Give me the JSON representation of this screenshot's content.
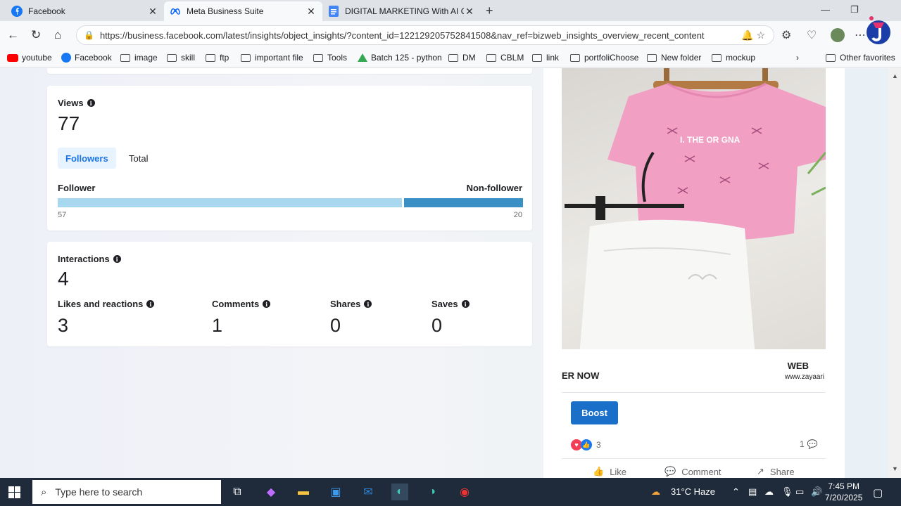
{
  "browser": {
    "tabs": [
      {
        "title": "Facebook",
        "icon": "facebook-icon"
      },
      {
        "title": "Meta Business Suite",
        "icon": "meta-icon"
      },
      {
        "title": "DIGITAL MARKETING With AI Onl",
        "icon": "docs-icon"
      }
    ],
    "url": "https://business.facebook.com/latest/insights/object_insights/?content_id=122129205752841508&nav_ref=bizweb_insights_overview_recent_content",
    "bookmarks": [
      "youtube",
      "Facebook",
      "image",
      "skill",
      "ftp",
      "important file",
      "Tools",
      "Batch 125 - python",
      "DM",
      "CBLM",
      "link",
      "portfoliChoose",
      "New folder",
      "mockup"
    ],
    "other_favorites": "Other favorites"
  },
  "views": {
    "label": "Views",
    "total": "77",
    "tabs": [
      "Followers",
      "Total"
    ],
    "follower_label": "Follower",
    "nonfollower_label": "Non-follower",
    "follower_count": "57",
    "nonfollower_count": "20",
    "follower_share": 0.74
  },
  "interactions": {
    "label": "Interactions",
    "total": "4",
    "metrics": [
      {
        "label": "Likes and reactions",
        "value": "3"
      },
      {
        "label": "Comments",
        "value": "1"
      },
      {
        "label": "Shares",
        "value": "0"
      },
      {
        "label": "Saves",
        "value": "0"
      }
    ]
  },
  "post": {
    "shirt_text": "I. THE OR GNA",
    "order_text": "ER NOW",
    "web_label": "WEB",
    "web_url": "www.zayaari",
    "boost_label": "Boost",
    "reaction_count": "3",
    "comment_count": "1",
    "actions": [
      "Like",
      "Comment",
      "Share"
    ]
  },
  "taskbar": {
    "search_placeholder": "Type here to search",
    "weather": "31°C  Haze",
    "time": "7:45 PM",
    "date": "7/20/2025"
  },
  "colors": {
    "accent": "#1b74e4",
    "follower_bar": "#a8d8f0",
    "nonfollower_bar": "#3a8fc4",
    "boost": "#1a6fc9"
  }
}
